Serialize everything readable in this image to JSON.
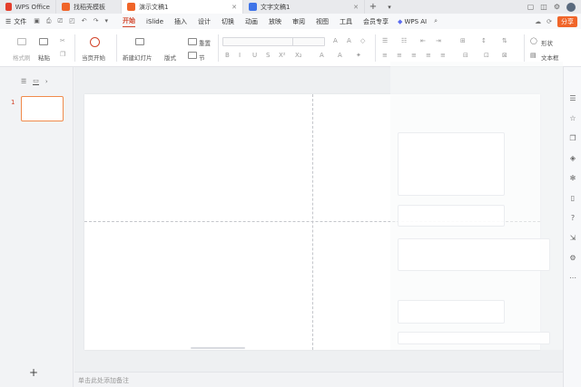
{
  "tabs": [
    {
      "label": "WPS Office",
      "color": "#e43f2d"
    },
    {
      "label": "找稻壳模板",
      "color": "#f06529"
    },
    {
      "label": "演示文稿1",
      "color": "#f06529",
      "active": true
    },
    {
      "label": "文字文稿1",
      "color": "#3f74e8"
    }
  ],
  "tabbar_icons": [
    "new-tab-icon",
    "window-icon",
    "layout-icon",
    "avatar"
  ],
  "menubar": {
    "file_label": "文件",
    "menus": [
      "开始",
      "iSlide",
      "插入",
      "设计",
      "切换",
      "动画",
      "放映",
      "审阅",
      "视图",
      "工具",
      "会员专享"
    ],
    "active_menu": "开始",
    "wps_ai_label": "WPS AI",
    "share_label": "分享"
  },
  "ribbon": {
    "format_painter": "格式刷",
    "paste": "粘贴",
    "play_from_current": "当页开始",
    "new_slide": "新建幻灯片",
    "layout": "版式",
    "section": "节",
    "reset": "重置",
    "shape": "形状",
    "textbox": "文本框",
    "font_glyphs": [
      "B",
      "I",
      "U",
      "S",
      "X²",
      "X₂",
      "A",
      "A"
    ]
  },
  "left_panel": {
    "slide_number": "1",
    "add_slide_label": "+"
  },
  "notes_placeholder": "单击此处添加备注",
  "colors": {
    "accent": "#d2442a",
    "share": "#f06529",
    "thumb_border": "#f08a4b"
  }
}
